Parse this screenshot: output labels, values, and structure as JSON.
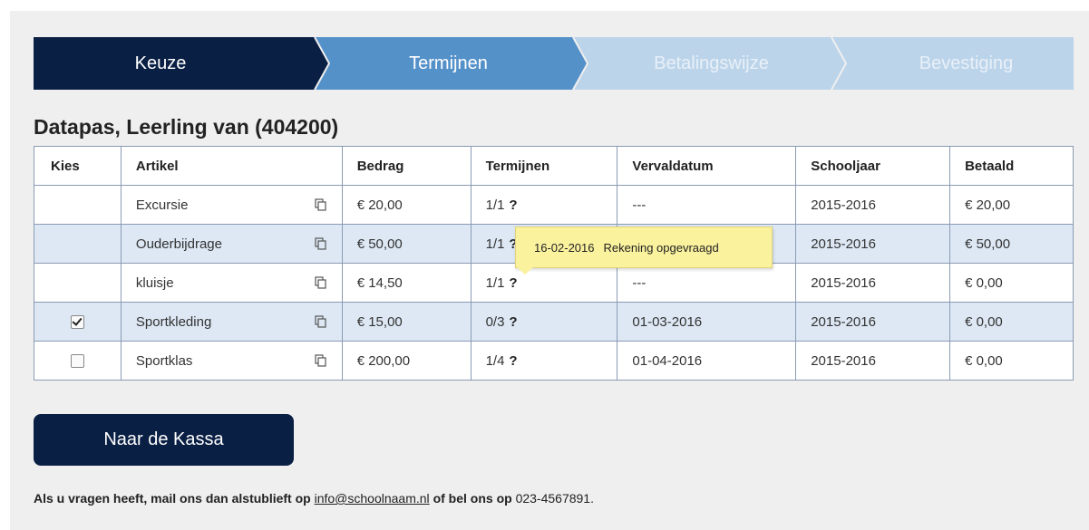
{
  "stepper": {
    "steps": [
      {
        "label": "Keuze",
        "state": "active"
      },
      {
        "label": "Termijnen",
        "state": "next"
      },
      {
        "label": "Betalingswijze",
        "state": "inactive"
      },
      {
        "label": "Bevestiging",
        "state": "inactive"
      }
    ],
    "colors": {
      "active": "#0a1f44",
      "next": "#5591c9",
      "inactive": "#bcd4ea"
    }
  },
  "section_title": "Datapas, Leerling van (404200)",
  "table": {
    "headers": [
      "Kies",
      "Artikel",
      "Bedrag",
      "Termijnen",
      "Vervaldatum",
      "Schooljaar",
      "Betaald"
    ],
    "rows": [
      {
        "kies": "",
        "artikel": "Excursie",
        "bedrag": "€ 20,00",
        "termijnen": "1/1",
        "help": "?",
        "vervaldatum": "---",
        "schooljaar": "2015-2016",
        "betaald": "€ 20,00"
      },
      {
        "kies": "",
        "artikel": "Ouderbijdrage",
        "bedrag": "€ 50,00",
        "termijnen": "1/1",
        "help": "?",
        "vervaldatum": "",
        "schooljaar": "2015-2016",
        "betaald": "€ 50,00"
      },
      {
        "kies": "",
        "artikel": "kluisje",
        "bedrag": "€ 14,50",
        "termijnen": "1/1",
        "help": "?",
        "vervaldatum": "---",
        "schooljaar": "2015-2016",
        "betaald": "€ 0,00"
      },
      {
        "kies": "checked",
        "artikel": "Sportkleding",
        "bedrag": "€ 15,00",
        "termijnen": "0/3",
        "help": "?",
        "vervaldatum": "01-03-2016",
        "schooljaar": "2015-2016",
        "betaald": "€ 0,00"
      },
      {
        "kies": "unchecked",
        "artikel": "Sportklas",
        "bedrag": "€ 200,00",
        "termijnen": "1/4",
        "help": "?",
        "vervaldatum": "01-04-2016",
        "schooljaar": "2015-2016",
        "betaald": "€ 0,00"
      }
    ]
  },
  "tooltip": {
    "date": "16-02-2016",
    "text": "Rekening opgevraagd"
  },
  "kassa_button": "Naar de Kassa",
  "footer": {
    "text_before": "Als u vragen heeft, mail ons dan alstublieft op",
    "email": "info@schoolnaam.nl",
    "text_middle": "of bel ons op",
    "phone": "023-4567891."
  }
}
